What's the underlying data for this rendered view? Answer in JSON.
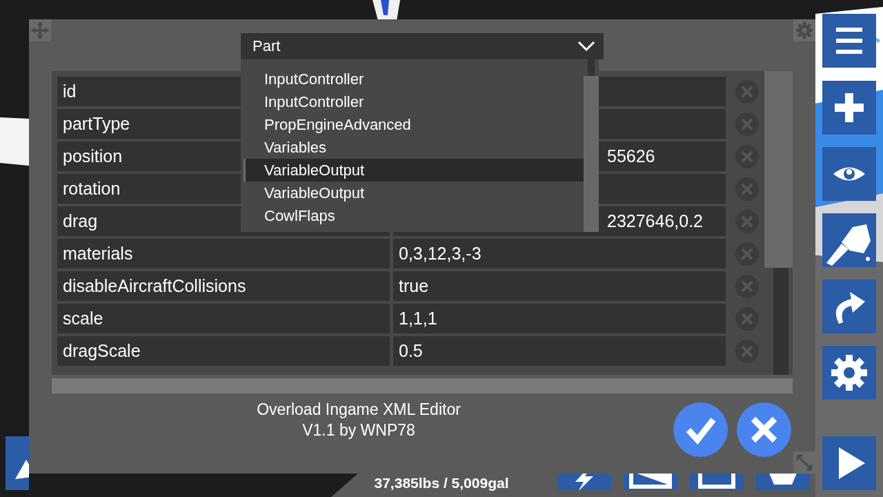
{
  "dropdown": {
    "value": "Part",
    "items": [
      {
        "label": "InputController",
        "selected": false
      },
      {
        "label": "InputController",
        "selected": false
      },
      {
        "label": "PropEngineAdvanced",
        "selected": false
      },
      {
        "label": "Variables",
        "selected": false
      },
      {
        "label": "VariableOutput",
        "selected": true
      },
      {
        "label": "VariableOutput",
        "selected": false
      },
      {
        "label": "CowlFlaps",
        "selected": false
      }
    ]
  },
  "properties": [
    {
      "key": "id"
    },
    {
      "key": "partType"
    },
    {
      "key": "position",
      "value": "55626",
      "overlapped": true
    },
    {
      "key": "rotation"
    },
    {
      "key": "drag",
      "value": "2327646,0.2",
      "overlapped": true
    },
    {
      "key": "materials",
      "value": "0,3,12,3,-3"
    },
    {
      "key": "disableAircraftCollisions",
      "value": "true"
    },
    {
      "key": "scale",
      "value": "1,1,1"
    },
    {
      "key": "dragScale",
      "value": "0.5"
    }
  ],
  "footer": {
    "title": "Overload Ingame XML Editor",
    "version": "V1.1 by WNP78"
  },
  "stats": "37,385lbs / 5,009gal"
}
